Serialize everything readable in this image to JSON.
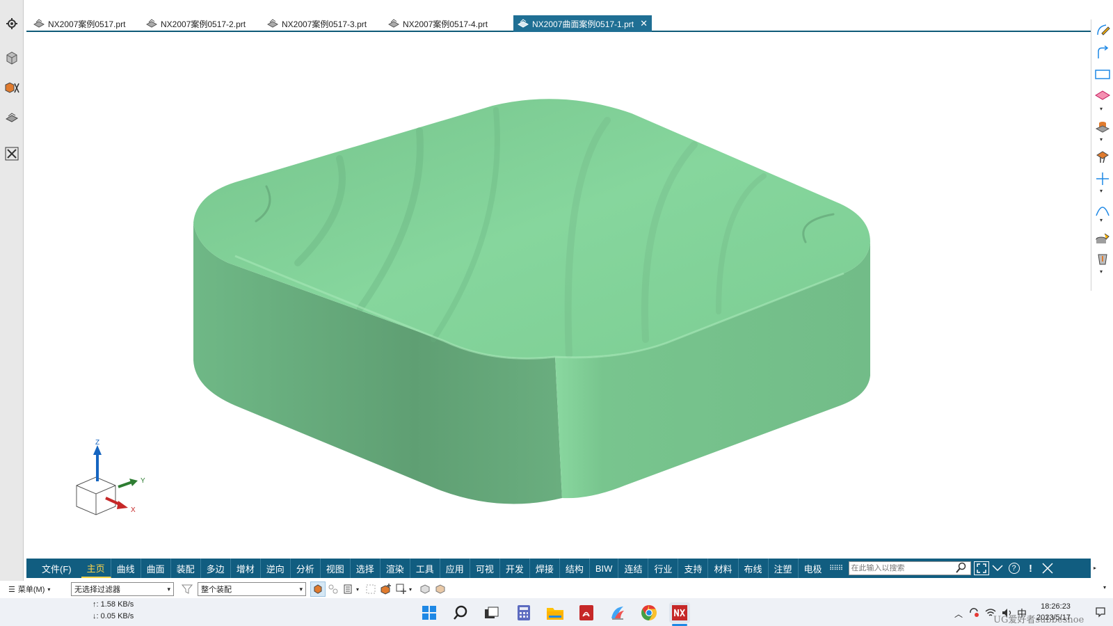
{
  "doc_tabs": [
    {
      "label": "NX2007案例0517.prt"
    },
    {
      "label": "NX2007案例0517-2.prt"
    },
    {
      "label": "NX2007案例0517-3.prt"
    },
    {
      "label": "NX2007案例0517-4.prt"
    },
    {
      "label": "NX2007曲面案例0517-1.prt",
      "active": true,
      "close": "✕"
    }
  ],
  "triad": {
    "z": "Z",
    "y": "Y",
    "x": "X"
  },
  "ribbon": {
    "tabs": [
      "文件(F)",
      "主页",
      "曲线",
      "曲面",
      "装配",
      "多边",
      "增材",
      "逆向",
      "分析",
      "视图",
      "选择",
      "渲染",
      "工具",
      "应用",
      "可视",
      "开发",
      "焊接",
      "结构",
      "BIW",
      "连结",
      "行业",
      "支持",
      "材料",
      "布线",
      "注塑",
      "电极"
    ],
    "active_tab": "主页",
    "search_placeholder": "在此输入以搜索",
    "help": "?",
    "alert": "!"
  },
  "selection_bar": {
    "menu_label": "菜单(M)",
    "filter_value": "无选择过滤器",
    "scope_value": "整个装配"
  },
  "taskbar": {
    "net_up": "↑: 1.58 KB/s",
    "net_down": "↓: 0.05 KB/s",
    "ime": "中",
    "time": "18:26:23",
    "date": "2023/5/17",
    "watermark": "UG爱好者subbeshoe"
  },
  "colors": {
    "ribbon": "#115d80",
    "tab_active": "#1f6f94",
    "ribbon_active_text": "#ffd54a",
    "model_green": "#7fcf94"
  }
}
